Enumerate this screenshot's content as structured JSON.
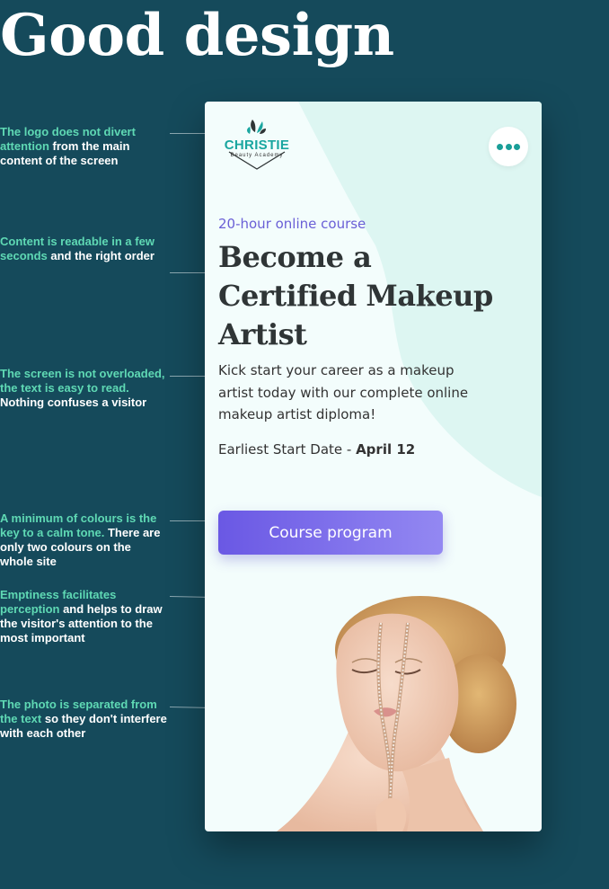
{
  "page_title": "Good design",
  "annotations": [
    {
      "highlight": "The logo does not divert attention",
      "text": " from the main content of the screen"
    },
    {
      "highlight": "Content is readable in a few seconds",
      "text": " and the right order"
    },
    {
      "highlight": "The screen is not overloaded, the text is easy to read.",
      "text": " Nothing confuses a visitor"
    },
    {
      "highlight": "A minimum of colours is the key to a calm tone.",
      "text": " There are only two colours on the whole site"
    },
    {
      "highlight": "Emptiness facilitates perception",
      "text": " and helps to draw the visitor's attention to the most important"
    },
    {
      "highlight": "The photo is separated from the text",
      "text": " so they don't interfere with each other"
    }
  ],
  "mockup": {
    "logo": {
      "name": "CHRISTIE",
      "subtitle": "Beauty Academy",
      "icon": "leaf-heart-logo-icon"
    },
    "menu": {
      "icon": "more-dots-icon"
    },
    "eyebrow": "20-hour online course",
    "headline": "Become a Certified Makeup Artist",
    "description": "Kick start your career as a makeup artist today with our complete online makeup artist diploma!",
    "start_date": {
      "label": "Earliest Start Date - ",
      "value": "April 12"
    },
    "cta_label": "Course program",
    "photo": {
      "icon": "model-face-with-zipper-photo"
    }
  },
  "colors": {
    "background": "#154a5b",
    "highlight": "#5fd9b4",
    "brand_teal": "#1aa6a0",
    "accent_purple": "#6a58e4",
    "screen_bg": "#f3fdfc"
  }
}
